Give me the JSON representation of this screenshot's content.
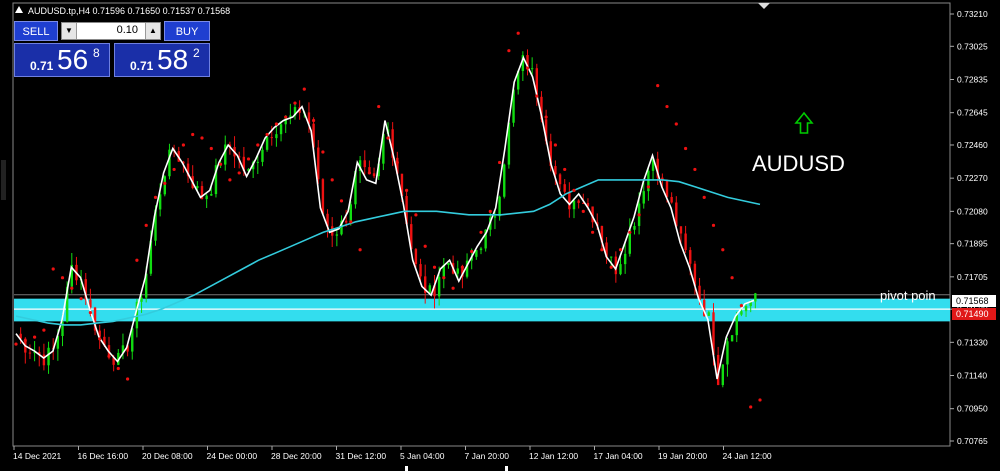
{
  "header": {
    "title": "AUDUSD.tp,H4  0.71596 0.71650 0.71537 0.71568"
  },
  "trade_panel": {
    "sell_label": "SELL",
    "buy_label": "BUY",
    "lot_value": "0.10",
    "sell_price_small": "0.71",
    "sell_price_big": "56",
    "sell_price_sup": "8",
    "buy_price_small": "0.71",
    "buy_price_big": "58",
    "buy_price_sup": "2"
  },
  "annotation": {
    "symbol_text": "AUDUSD",
    "pivot_text": "pivot poin",
    "arrow_color": "#00cc00"
  },
  "price_labels": {
    "current": "0.71568",
    "secondary": "0.71490"
  },
  "colors": {
    "bull": "#11dd11",
    "bear": "#ee1111",
    "ma_fast": "#ffffff",
    "ma_slow": "#33ccdd",
    "sar": "#ee1111",
    "zone": "#33ddee",
    "axis_bg": "#ffffff"
  },
  "chart_data": {
    "type": "candlestick",
    "symbol": "AUDUSD.tp",
    "timeframe": "H4",
    "ohlc": {
      "open": 0.71596,
      "high": 0.7165,
      "low": 0.71537,
      "close": 0.71568
    },
    "ylim": [
      0.70765,
      0.7321
    ],
    "y_ticks": [
      0.7321,
      0.73025,
      0.72835,
      0.72645,
      0.7246,
      0.7227,
      0.7208,
      0.71895,
      0.71705,
      0.7152,
      0.7133,
      0.7114,
      0.7095,
      0.70765
    ],
    "x_ticks": [
      "14 Dec 2021",
      "16 Dec 16:00",
      "20 Dec 08:00",
      "24 Dec 00:00",
      "28 Dec 20:00",
      "31 Dec 12:00",
      "5 Jan 04:00",
      "7 Jan 20:00",
      "12 Jan 12:00",
      "17 Jan 04:00",
      "19 Jan 20:00",
      "24 Jan 12:00"
    ],
    "pivot_zone": [
      0.7145,
      0.7158
    ],
    "pivot_line": 0.7152,
    "close_path": [
      0.7138,
      0.7131,
      0.7128,
      0.7124,
      0.7128,
      0.7146,
      0.7176,
      0.717,
      0.7152,
      0.7136,
      0.7128,
      0.7122,
      0.713,
      0.715,
      0.717,
      0.7205,
      0.723,
      0.7244,
      0.7236,
      0.7226,
      0.7216,
      0.722,
      0.7236,
      0.7246,
      0.724,
      0.7228,
      0.7238,
      0.725,
      0.7256,
      0.726,
      0.7262,
      0.7268,
      0.7254,
      0.721,
      0.7196,
      0.7198,
      0.7208,
      0.7236,
      0.7226,
      0.7224,
      0.726,
      0.7238,
      0.7212,
      0.718,
      0.7165,
      0.716,
      0.7175,
      0.718,
      0.7168,
      0.7178,
      0.7188,
      0.7196,
      0.721,
      0.7244,
      0.7282,
      0.7296,
      0.7285,
      0.7262,
      0.7235,
      0.7218,
      0.7212,
      0.7218,
      0.721,
      0.72,
      0.7182,
      0.7175,
      0.719,
      0.7205,
      0.7225,
      0.724,
      0.7222,
      0.721,
      0.719,
      0.7176,
      0.7158,
      0.7146,
      0.7112,
      0.7136,
      0.7148,
      0.7155,
      0.7157
    ],
    "ma_slow": [
      0.7148,
      0.7146,
      0.7144,
      0.7143,
      0.7143,
      0.7144,
      0.7145,
      0.7147,
      0.7149,
      0.7152,
      0.7156,
      0.716,
      0.7165,
      0.717,
      0.7175,
      0.718,
      0.7184,
      0.7188,
      0.7192,
      0.7196,
      0.7199,
      0.7202,
      0.7204,
      0.7206,
      0.7208,
      0.7208,
      0.7208,
      0.7207,
      0.7206,
      0.7206,
      0.7206,
      0.7207,
      0.7208,
      0.7212,
      0.7218,
      0.7222,
      0.7226,
      0.7226,
      0.7226,
      0.7226,
      0.7226,
      0.7225,
      0.7222,
      0.7219,
      0.7216,
      0.7214,
      0.7212
    ],
    "sar": [
      0.7132,
      0.7134,
      0.7136,
      0.714,
      0.7175,
      0.717,
      0.7164,
      0.7158,
      0.715,
      0.7135,
      0.7125,
      0.7118,
      0.7112,
      0.718,
      0.72,
      0.7216,
      0.7224,
      0.7232,
      0.7246,
      0.7252,
      0.725,
      0.7244,
      0.7235,
      0.7226,
      0.723,
      0.7238,
      0.7246,
      0.7252,
      0.7258,
      0.7262,
      0.727,
      0.7278,
      0.726,
      0.7242,
      0.7226,
      0.7214,
      0.7202,
      0.7186,
      0.723,
      0.7268,
      0.725,
      0.7236,
      0.722,
      0.7206,
      0.7188,
      0.7176,
      0.717,
      0.7164,
      0.7176,
      0.7185,
      0.7196,
      0.7208,
      0.7236,
      0.73,
      0.731,
      0.729,
      0.7274,
      0.7262,
      0.7246,
      0.7232,
      0.722,
      0.7208,
      0.7196,
      0.7186,
      0.7176,
      0.7186,
      0.7196,
      0.7206,
      0.7222,
      0.728,
      0.7268,
      0.7258,
      0.7244,
      0.7232,
      0.7216,
      0.72,
      0.7186,
      0.717,
      0.7154,
      0.7096,
      0.71
    ]
  }
}
